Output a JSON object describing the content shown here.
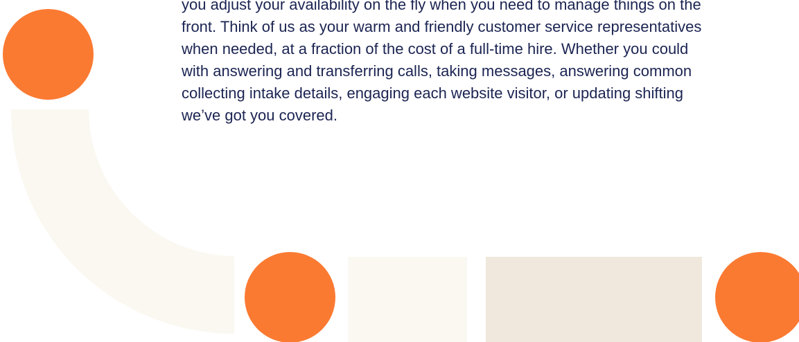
{
  "content": {
    "paragraph_lines": [
      "you adjust your availability on the fly when you need to manage things on the",
      "front. Think of us as your warm and friendly customer service representatives",
      "when needed, at a fraction of the cost of a full-time hire. Whether you could",
      "with answering and transferring calls, taking messages, answering common",
      "collecting intake details, engaging each website visitor, or updating shifting",
      "we’ve got you covered."
    ]
  },
  "colors": {
    "accent_orange": "#fb7a32",
    "cream_light": "#fbf8f1",
    "beige": "#f0e8dc",
    "text_navy": "#1b2452"
  }
}
